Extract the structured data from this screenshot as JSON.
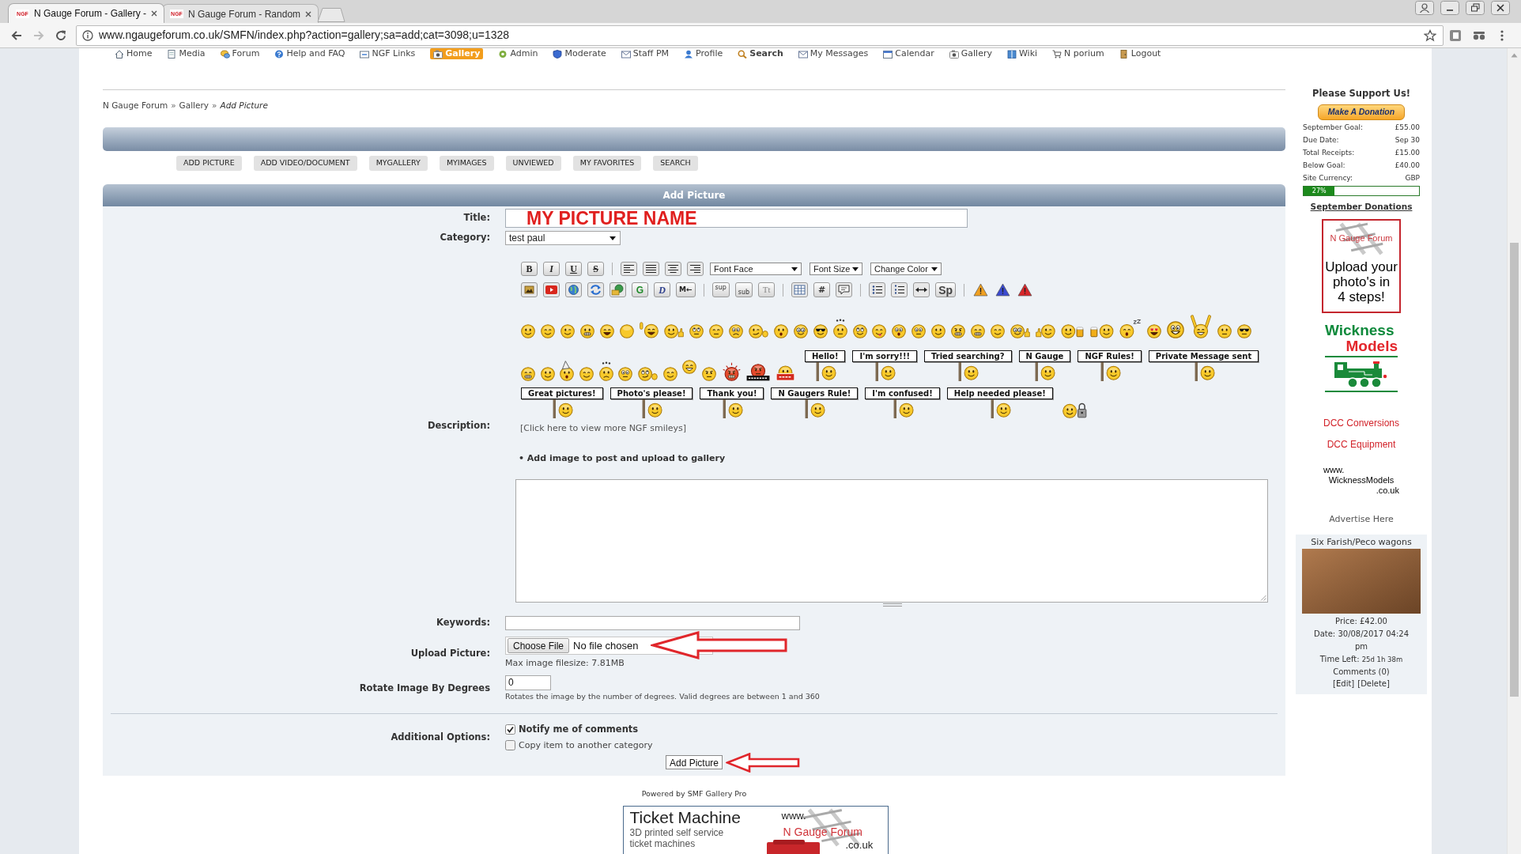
{
  "browser": {
    "tabs": [
      {
        "icon_text": "NGF",
        "title": "N Gauge Forum - Gallery -",
        "selected": true
      },
      {
        "icon_text": "NGF",
        "title": "N Gauge Forum - Random",
        "selected": false
      }
    ],
    "url": "www.ngaugeforum.co.uk/SMFN/index.php?action=gallery;sa=add;cat=3098;u=1328"
  },
  "nav_menu": [
    {
      "label": "Home",
      "selected": false,
      "emphasized": false
    },
    {
      "label": "Media",
      "selected": false,
      "emphasized": false
    },
    {
      "label": "Forum",
      "selected": false,
      "emphasized": false
    },
    {
      "label": "Help and FAQ",
      "selected": false,
      "emphasized": false
    },
    {
      "label": "NGF Links",
      "selected": false,
      "emphasized": false
    },
    {
      "label": "Gallery",
      "selected": true,
      "emphasized": true
    },
    {
      "label": "Admin",
      "selected": false,
      "emphasized": false
    },
    {
      "label": "Moderate",
      "selected": false,
      "emphasized": false
    },
    {
      "label": "Staff PM",
      "selected": false,
      "emphasized": false
    },
    {
      "label": "Profile",
      "selected": false,
      "emphasized": false
    },
    {
      "label": "Search",
      "selected": false,
      "emphasized": true
    },
    {
      "label": "My Messages",
      "selected": false,
      "emphasized": false
    },
    {
      "label": "Calendar",
      "selected": false,
      "emphasized": false
    },
    {
      "label": "Gallery",
      "selected": false,
      "emphasized": false
    },
    {
      "label": "Wiki",
      "selected": false,
      "emphasized": false
    },
    {
      "label": "N porium",
      "selected": false,
      "emphasized": false
    },
    {
      "label": "Logout",
      "selected": false,
      "emphasized": false
    }
  ],
  "breadcrumb": [
    {
      "label": "N Gauge Forum",
      "separator": "»",
      "current": false
    },
    {
      "label": "Gallery",
      "separator": "»",
      "current": false
    },
    {
      "label": "Add Picture",
      "current": true
    }
  ],
  "gallery_menu": [
    "ADD PICTURE",
    "ADD VIDEO/DOCUMENT",
    "MYGALLERY",
    "MYIMAGES",
    "UNVIEWED",
    "MY FAVORITES",
    "SEARCH"
  ],
  "form": {
    "header": "Add Picture",
    "title": {
      "label": "Title:",
      "value": "MY PICTURE NAME"
    },
    "category": {
      "label": "Category:",
      "value": "test paul"
    },
    "description": {
      "label": "Description:",
      "format_buttons": [
        "B",
        "I",
        "U",
        "S"
      ],
      "dropdowns": [
        "Font Face",
        "Font Size",
        "Change Color"
      ],
      "insert_buttons": [
        "G",
        "D",
        "M←",
        "sup",
        "sub",
        "Tt",
        "#",
        "Sp"
      ],
      "smiley_signs_row_1": [
        "Hello!",
        "I'm sorry!!!",
        "Tried searching?",
        "N Gauge",
        "NGF Rules!",
        "Private Message sent"
      ],
      "smiley_signs_row_2": [
        "Great pictures!",
        "Photo's please!",
        "Thank you!",
        "N Gaugers Rule!",
        "I'm confused!",
        "Help needed please!"
      ],
      "more_smileys_link": "[Click here to view more NGF smileys]",
      "upload_note": "• Add image to post and upload to gallery"
    },
    "keywords": {
      "label": "Keywords:"
    },
    "upload": {
      "label": "Upload Picture:",
      "button": "Choose File",
      "status": "No file chosen",
      "note": "Max image filesize: 7.81MB"
    },
    "rotate": {
      "label": "Rotate Image By Degrees",
      "value": "0",
      "note": "Rotates the image by the number of degrees. Valid degrees are between 1 and 360"
    },
    "options": {
      "label": "Additional Options:",
      "items": [
        {
          "label": "Notify me of comments",
          "checked": true,
          "emphasized": true
        },
        {
          "label": "Copy item to another category",
          "checked": false,
          "emphasized": false
        }
      ]
    },
    "submit": "Add Picture"
  },
  "powered_by": "Powered by SMF Gallery Pro",
  "footer_ad": {
    "title": "Ticket Machine",
    "subtitle": "3D printed self service ticket machines",
    "web_prefix": "www.",
    "brand": "N Gauge Forum",
    "web_suffix": ".co.uk"
  },
  "sidebar": {
    "heading": "Please Support Us!",
    "donate_button": "Make A Donation",
    "stats": [
      {
        "label": "September Goal:",
        "value": "£55.00"
      },
      {
        "label": "Due Date:",
        "value": "Sep 30"
      },
      {
        "label": "Total Receipts:",
        "value": "£15.00"
      },
      {
        "label": "Below Goal:",
        "value": "£40.00"
      },
      {
        "label": "Site Currency:",
        "value": "GBP"
      }
    ],
    "progress": {
      "level": 0.27,
      "reading": "27%"
    },
    "donations_link": "September Donations",
    "upload_ad": {
      "brand": "N Gauge Forum",
      "text": "Upload your\nphoto's in\n4 steps!"
    },
    "wickness_logo": [
      "Wickness",
      "Models"
    ],
    "links": [
      "DCC Conversions",
      "DCC Equipment"
    ],
    "web_address": [
      "www.",
      "WicknessModels",
      ".co.uk"
    ],
    "advertise": "Advertise Here",
    "listing": {
      "title": "Six Farish/Peco wagons",
      "price": "Price: £42.00",
      "date": "Date: 30/08/2017 04:24 pm",
      "time_left_label": "Time Left:",
      "time_left": "25d 1h 38m",
      "comments": "Comments (0)",
      "actions": [
        "[Edit]",
        "[Delete]"
      ]
    }
  }
}
